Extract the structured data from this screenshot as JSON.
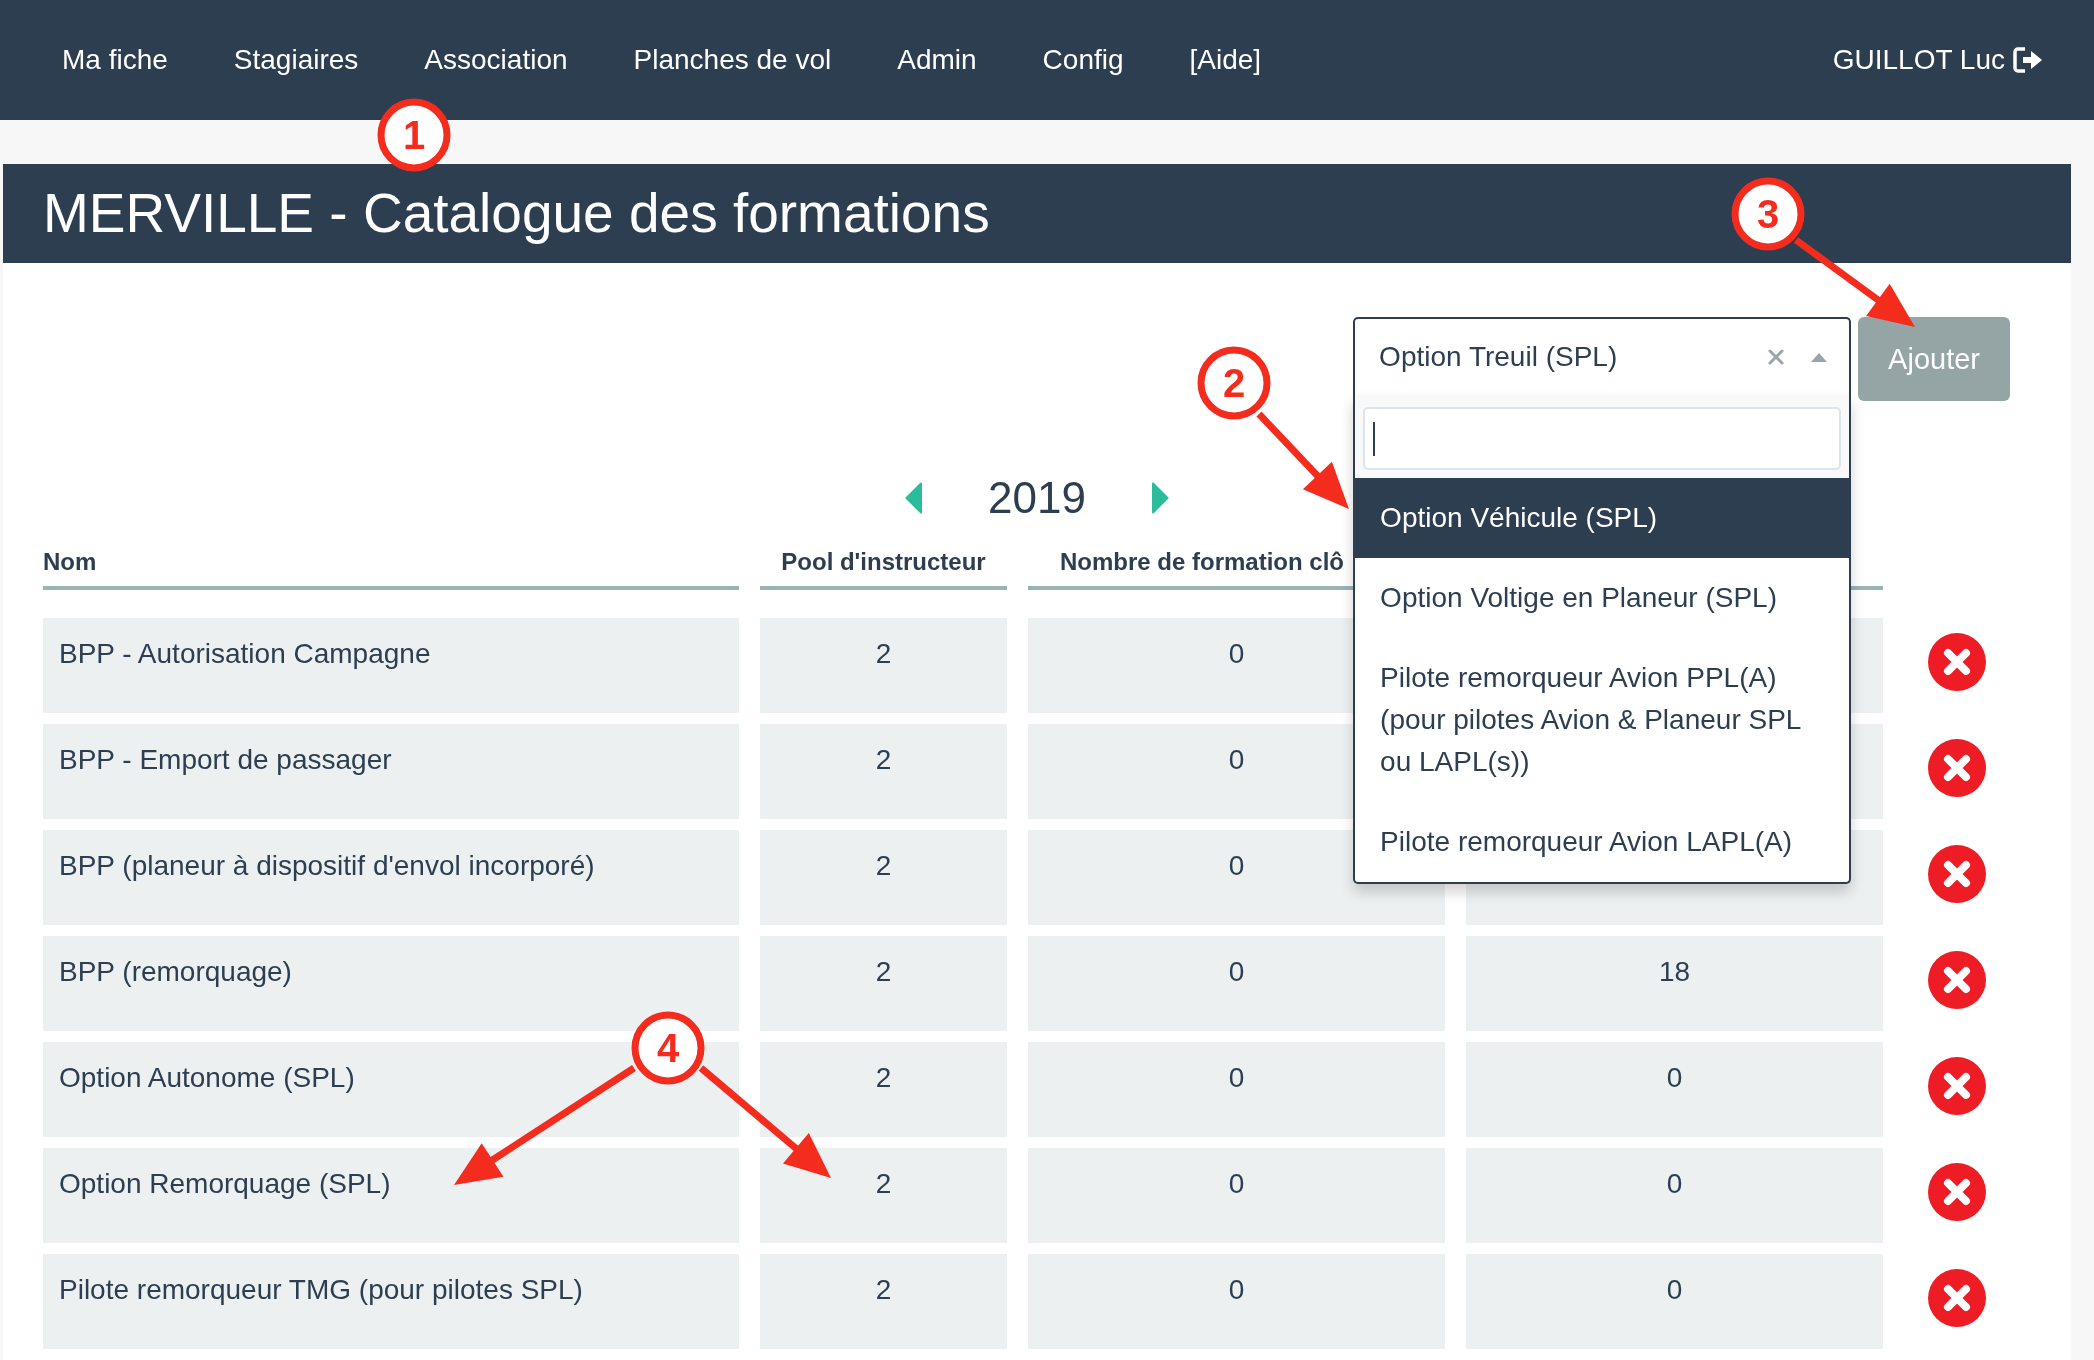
{
  "nav": {
    "items": [
      "Ma fiche",
      "Stagiaires",
      "Association",
      "Planches de vol",
      "Admin",
      "Config",
      "[Aide]"
    ],
    "user": "GUILLOT Luc"
  },
  "title": "MERVILLE - Catalogue des formations",
  "formation_select": {
    "value": "Option Treuil (SPL)",
    "open": true,
    "search": {
      "focused": true
    },
    "options": [
      {
        "label": "Option Véhicule (SPL)",
        "selected": true
      },
      {
        "label": "Option Voltige en Planeur (SPL)",
        "selected": false
      },
      {
        "label": "Pilote remorqueur Avion PPL(A) (pour pilotes Avion & Planeur SPL ou LAPL(s))",
        "selected": false
      },
      {
        "label": "Pilote remorqueur Avion LAPL(A)",
        "selected": false
      }
    ]
  },
  "add_button": "Ajouter",
  "year_nav": {
    "year": "2019"
  },
  "table": {
    "columns": [
      "Nom",
      "Pool d'instructeur",
      "Nombre de formation clô"
    ],
    "rows": [
      {
        "cells": [
          "BPP - Autorisation Campagne",
          "2",
          "0"
        ]
      },
      {
        "cells": [
          "BPP - Emport de passager",
          "2",
          "0"
        ]
      },
      {
        "cells": [
          "BPP (planeur à dispositif d'envol incorporé)",
          "2",
          "0"
        ]
      },
      {
        "cells": [
          "BPP (remorquage)",
          "2",
          "0",
          "18"
        ]
      },
      {
        "cells": [
          "Option Autonome (SPL)",
          "2",
          "0",
          "0"
        ]
      },
      {
        "cells": [
          "Option Remorquage (SPL)",
          "2",
          "0",
          "0"
        ]
      },
      {
        "cells": [
          "Pilote remorqueur TMG (pour pilotes SPL)",
          "2",
          "0",
          "0"
        ]
      }
    ]
  },
  "annotations": [
    {
      "label": "1"
    },
    {
      "label": "2"
    },
    {
      "label": "3"
    },
    {
      "label": "4"
    }
  ]
}
